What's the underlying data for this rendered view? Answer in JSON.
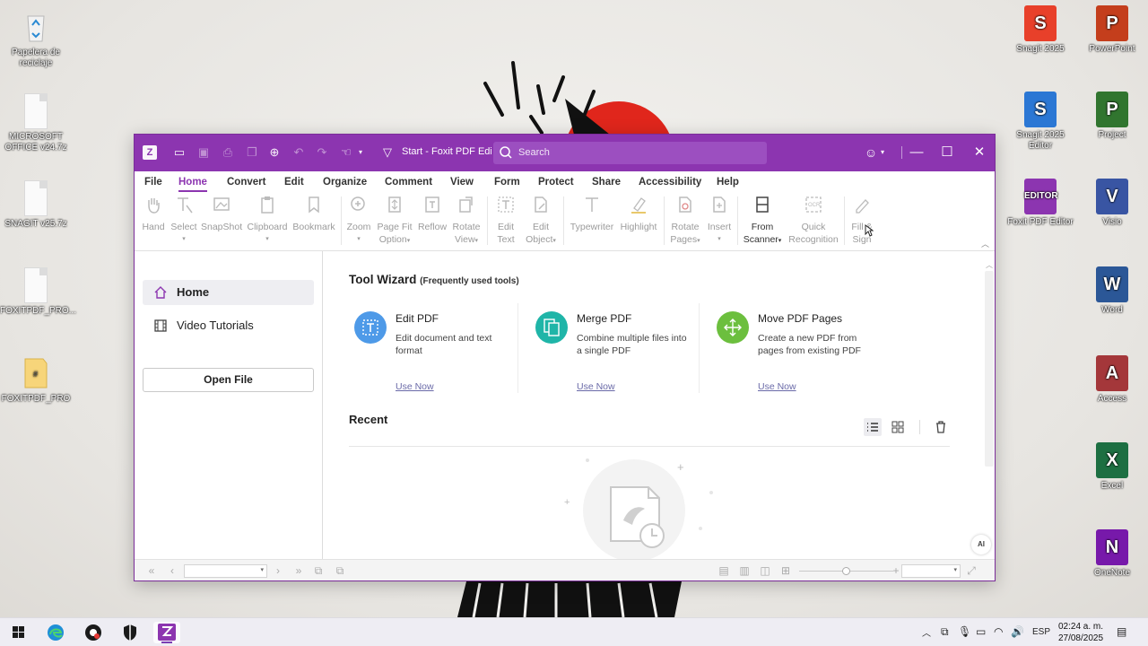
{
  "desktop": {
    "left_icons": [
      {
        "label": "Papelera de reciclaje",
        "icon": "recycle-bin-icon"
      },
      {
        "label": "MICROSOFT OFFICE v24.7z",
        "icon": "file-icon"
      },
      {
        "label": "SNAGIT v25.7z",
        "icon": "file-icon"
      },
      {
        "label": "FOXITPDF_PRO...",
        "icon": "file-icon"
      },
      {
        "label": "FOXITPDF_PRO",
        "icon": "folder-icon"
      }
    ],
    "right_icons": [
      {
        "label": "Snagit 2025",
        "letter": "S",
        "color": "#e8402a"
      },
      {
        "label": "PowerPoint",
        "letter": "P",
        "color": "#c43e1c"
      },
      {
        "label": "Snagit 2025 Editor",
        "letter": "S",
        "color": "#2b77d4"
      },
      {
        "label": "Project",
        "letter": "P",
        "color": "#31752f"
      },
      {
        "label": "Foxit PDF Editor",
        "letter": "EDITOR",
        "color": "#8c35b0"
      },
      {
        "label": "Visio",
        "letter": "V",
        "color": "#3955a3"
      },
      {
        "label": "Word",
        "letter": "W",
        "color": "#2b5797"
      },
      {
        "label": "Access",
        "letter": "A",
        "color": "#a4373a"
      },
      {
        "label": "Excel",
        "letter": "X",
        "color": "#1d6f42"
      },
      {
        "label": "OneNote",
        "letter": "N",
        "color": "#7719aa"
      }
    ]
  },
  "window": {
    "title": "Start - Foxit PDF Edi...",
    "search_placeholder": "Search",
    "accent": "#8c35b0",
    "menu": [
      "File",
      "Home",
      "Convert",
      "Edit",
      "Organize",
      "Comment",
      "View",
      "Form",
      "Protect",
      "Share",
      "Accessibility",
      "Help"
    ],
    "active_menu": "Home",
    "ribbon": {
      "hand": "Hand",
      "select": "Select",
      "snapshot": "SnapShot",
      "clipboard": "Clipboard",
      "bookmark": "Bookmark",
      "zoom": "Zoom",
      "page_fit_1": "Page Fit",
      "page_fit_2": "Option",
      "reflow": "Reflow",
      "rotate_view_1": "Rotate",
      "rotate_view_2": "View",
      "edit_text_1": "Edit",
      "edit_text_2": "Text",
      "edit_object_1": "Edit",
      "edit_object_2": "Object",
      "typewriter": "Typewriter",
      "highlight": "Highlight",
      "rotate_pages_1": "Rotate",
      "rotate_pages_2": "Pages",
      "insert": "Insert",
      "from_scanner_1": "From",
      "from_scanner_2": "Scanner",
      "quick_recognition_1": "Quick",
      "quick_recognition_2": "Recognition",
      "fill_sign_1": "Fill &",
      "fill_sign_2": "Sign"
    },
    "sidebar": {
      "home": "Home",
      "video_tutorials": "Video Tutorials",
      "open_file": "Open File"
    },
    "tool_wizard": {
      "title": "Tool Wizard",
      "subtitle": "(Frequently used tools)",
      "cards": [
        {
          "title": "Edit PDF",
          "desc": "Edit document and text format",
          "link": "Use Now",
          "color": "#4e9ae8"
        },
        {
          "title": "Merge PDF",
          "desc": "Combine multiple files into a single PDF",
          "link": "Use Now",
          "color": "#1fb5a8"
        },
        {
          "title": "Move PDF Pages",
          "desc": "Create a new PDF from pages from existing PDF",
          "link": "Use Now",
          "color": "#6cbf3e"
        }
      ]
    },
    "recent": {
      "title": "Recent"
    }
  },
  "taskbar": {
    "language": "ESP",
    "time": "02:24 a. m.",
    "date": "27/08/2025"
  }
}
